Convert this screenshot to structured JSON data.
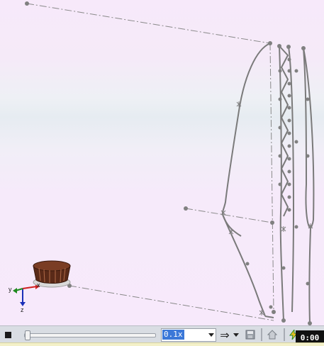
{
  "viewport": {
    "background": "#f7e9fa",
    "geometry_color": "#808080",
    "axis_labels": {
      "x": "x",
      "y": "y",
      "z": "z"
    }
  },
  "playback": {
    "speed_value": "0.1x",
    "timer": "0:00",
    "icons": [
      "stop-icon",
      "forward-arrow-icon",
      "save-icon",
      "home-icon",
      "energy-icon"
    ]
  },
  "colors": {
    "selection": "#3b78d8",
    "toolbar": "#d9dde3",
    "model_brown": "#6e3520"
  }
}
